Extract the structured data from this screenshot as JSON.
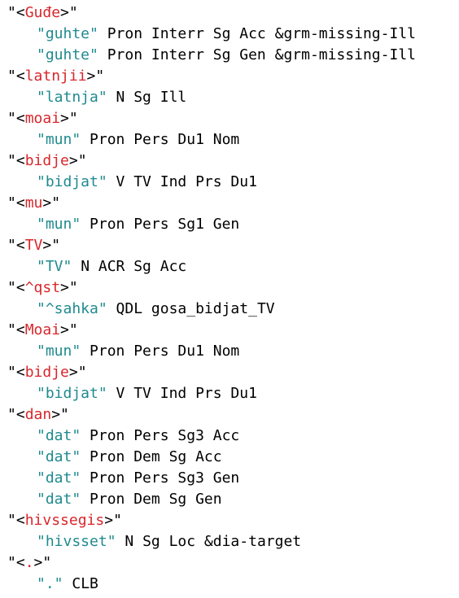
{
  "cohorts": [
    {
      "wordform": "Guđe",
      "readings": [
        {
          "lemma": "guhte",
          "tags": "Pron Interr Sg Acc &grm-missing-Ill"
        },
        {
          "lemma": "guhte",
          "tags": "Pron Interr Sg Gen &grm-missing-Ill"
        }
      ]
    },
    {
      "wordform": "latnjii",
      "readings": [
        {
          "lemma": "latnja",
          "tags": "N Sg Ill"
        }
      ]
    },
    {
      "wordform": "moai",
      "readings": [
        {
          "lemma": "mun",
          "tags": "Pron Pers Du1 Nom"
        }
      ]
    },
    {
      "wordform": "bidje",
      "readings": [
        {
          "lemma": "bidjat",
          "tags": "V TV Ind Prs Du1"
        }
      ]
    },
    {
      "wordform": "mu",
      "readings": [
        {
          "lemma": "mun",
          "tags": "Pron Pers Sg1 Gen"
        }
      ]
    },
    {
      "wordform": "TV",
      "readings": [
        {
          "lemma": "TV",
          "tags": "N ACR Sg Acc"
        }
      ]
    },
    {
      "wordform": "^qst",
      "readings": [
        {
          "lemma": "^sahka",
          "tags": "QDL gosa_bidjat_TV"
        }
      ]
    },
    {
      "wordform": "Moai",
      "readings": [
        {
          "lemma": "mun",
          "tags": "Pron Pers Du1 Nom"
        }
      ]
    },
    {
      "wordform": "bidje",
      "readings": [
        {
          "lemma": "bidjat",
          "tags": "V TV Ind Prs Du1"
        }
      ]
    },
    {
      "wordform": "dan",
      "readings": [
        {
          "lemma": "dat",
          "tags": "Pron Pers Sg3 Acc"
        },
        {
          "lemma": "dat",
          "tags": "Pron Dem Sg Acc"
        },
        {
          "lemma": "dat",
          "tags": "Pron Pers Sg3 Gen"
        },
        {
          "lemma": "dat",
          "tags": "Pron Dem Sg Gen"
        }
      ]
    },
    {
      "wordform": "hivssegis",
      "readings": [
        {
          "lemma": "hivsset",
          "tags": "N Sg Loc &dia-target"
        }
      ]
    },
    {
      "wordform": ".",
      "readings": [
        {
          "lemma": ".",
          "tags": "CLB"
        }
      ]
    }
  ],
  "colors": {
    "wordform": "#d8262b",
    "lemma": "#1f8a8f",
    "text": "#000000",
    "background": "#ffffff"
  }
}
